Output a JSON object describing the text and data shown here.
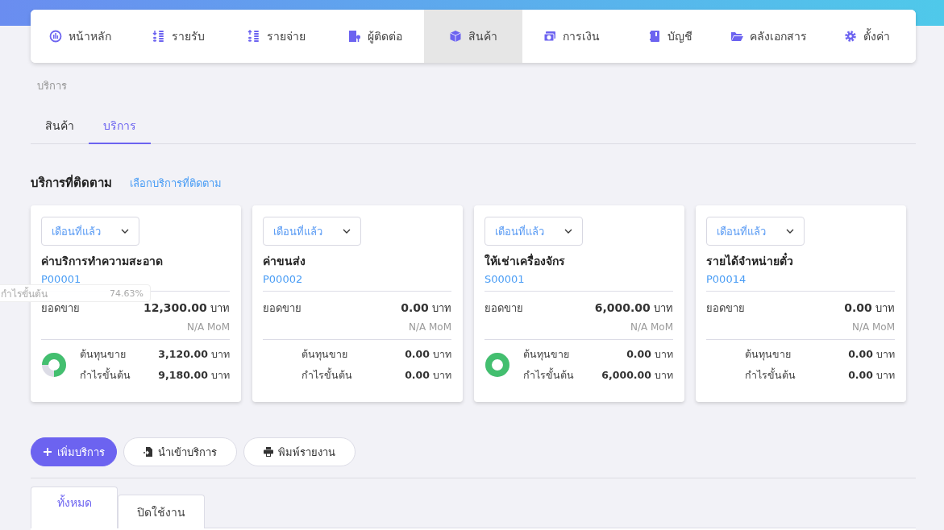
{
  "nav": [
    {
      "label": "หน้าหลัก",
      "selected": false
    },
    {
      "label": "รายรับ",
      "selected": false
    },
    {
      "label": "รายจ่าย",
      "selected": false
    },
    {
      "label": "ผู้ติดต่อ",
      "selected": false
    },
    {
      "label": "สินค้า",
      "selected": true
    },
    {
      "label": "การเงิน",
      "selected": false
    },
    {
      "label": "บัญชี",
      "selected": false
    },
    {
      "label": "คลังเอกสาร",
      "selected": false
    },
    {
      "label": "ตั้งค่า",
      "selected": false
    }
  ],
  "breadcrumb": "บริการ",
  "sub_tabs": [
    {
      "label": "สินค้า",
      "selected": false
    },
    {
      "label": "บริการ",
      "selected": true
    }
  ],
  "tracked": {
    "title": "บริการที่ติดตาม",
    "link": "เลือกบริการที่ติดตาม"
  },
  "cards": [
    {
      "period": "เดือนที่แล้ว",
      "name": "ค่าบริการทำความสะอาด",
      "code": "P00001",
      "sales_label": "ยอดขาย",
      "sales": "12,300.00",
      "unit": "บาท",
      "mom": "N/A MoM",
      "cost_label": "ต้นทุนขาย",
      "cost": "3,120.00",
      "cost_unit": "บาท",
      "profit_label": "กำไรขั้นต้น",
      "profit": "9,180.00",
      "profit_unit": "บาท",
      "donut": {
        "level": 0.7463
      },
      "tooltip": {
        "label": "กำไรขั้นต้น",
        "value": "74.63%"
      }
    },
    {
      "period": "เดือนที่แล้ว",
      "name": "ค่าขนส่ง",
      "code": "P00002",
      "sales_label": "ยอดขาย",
      "sales": "0.00",
      "unit": "บาท",
      "mom": "N/A MoM",
      "cost_label": "ต้นทุนขาย",
      "cost": "0.00",
      "cost_unit": "บาท",
      "profit_label": "กำไรขั้นต้น",
      "profit": "0.00",
      "profit_unit": "บาท"
    },
    {
      "period": "เดือนที่แล้ว",
      "name": "ให้เช่าเครื่องจักร",
      "code": "S00001",
      "sales_label": "ยอดขาย",
      "sales": "6,000.00",
      "unit": "บาท",
      "mom": "N/A MoM",
      "cost_label": "ต้นทุนขาย",
      "cost": "0.00",
      "cost_unit": "บาท",
      "profit_label": "กำไรขั้นต้น",
      "profit": "6,000.00",
      "profit_unit": "บาท",
      "donut": {
        "level": 1
      }
    },
    {
      "period": "เดือนที่แล้ว",
      "name": "รายได้จำหน่ายตั๋ว",
      "code": "P00014",
      "sales_label": "ยอดขาย",
      "sales": "0.00",
      "unit": "บาท",
      "mom": "N/A MoM",
      "cost_label": "ต้นทุนขาย",
      "cost": "0.00",
      "cost_unit": "บาท",
      "profit_label": "กำไรขั้นต้น",
      "profit": "0.00",
      "profit_unit": "บาท"
    }
  ],
  "actions": [
    {
      "label": "เพิ่มบริการ",
      "kind": "primary"
    },
    {
      "label": "นำเข้าบริการ",
      "kind": "outline"
    },
    {
      "label": "พิมพ์รายงาน",
      "kind": "outline"
    }
  ],
  "list_tabs": [
    {
      "label": "ทั้งหมด",
      "selected": true
    },
    {
      "label": "ปิดใช้งาน",
      "selected": false
    }
  ]
}
